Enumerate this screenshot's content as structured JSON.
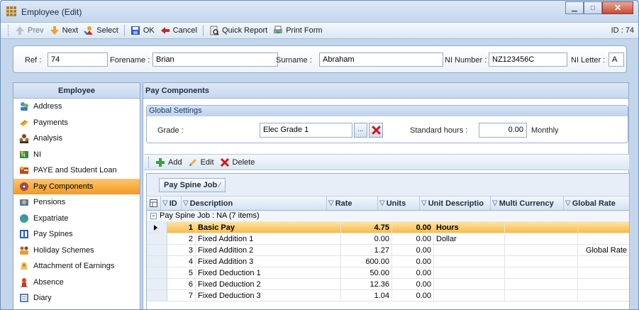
{
  "window": {
    "title": "Employee (Edit)",
    "id_label": "ID : 74"
  },
  "toolbar": {
    "prev": "Prev",
    "next": "Next",
    "select": "Select",
    "ok": "OK",
    "cancel": "Cancel",
    "quick_report": "Quick Report",
    "print_form": "Print Form"
  },
  "employee": {
    "ref_label": "Ref :",
    "ref": "74",
    "forename_label": "Forename :",
    "forename": "Brian",
    "surname_label": "Surname :",
    "surname": "Abraham",
    "ni_number_label": "NI Number :",
    "ni_number": "NZ123456C",
    "ni_letter_label": "NI Letter :",
    "ni_letter": "A"
  },
  "sidebar": {
    "title": "Employee",
    "items": [
      {
        "label": "Address",
        "icon": "address-icon"
      },
      {
        "label": "Payments",
        "icon": "payments-icon"
      },
      {
        "label": "Analysis",
        "icon": "analysis-icon"
      },
      {
        "label": "NI",
        "icon": "ni-icon"
      },
      {
        "label": "PAYE and Student Loan",
        "icon": "paye-icon"
      },
      {
        "label": "Pay Components",
        "icon": "pay-components-icon",
        "selected": true
      },
      {
        "label": "Pensions",
        "icon": "pensions-icon"
      },
      {
        "label": "Expatriate",
        "icon": "expatriate-icon"
      },
      {
        "label": "Pay Spines",
        "icon": "pay-spines-icon"
      },
      {
        "label": "Holiday Schemes",
        "icon": "holiday-schemes-icon"
      },
      {
        "label": "Attachment of Earnings",
        "icon": "attachment-icon"
      },
      {
        "label": "Absence",
        "icon": "absence-icon"
      },
      {
        "label": "Diary",
        "icon": "diary-icon"
      }
    ]
  },
  "main": {
    "title": "Pay Components",
    "global_settings": {
      "title": "Global Settings",
      "grade_label": "Grade :",
      "grade": "Elec Grade 1",
      "browse": "...",
      "std_hours_label": "Standard hours :",
      "std_hours": "0.00",
      "period": "Monthly"
    },
    "grid_toolbar": {
      "add": "Add",
      "edit": "Edit",
      "delete": "Delete"
    },
    "grid": {
      "group_by": "Pay Spine Job",
      "group_row": "Pay Spine Job : NA (7 items)",
      "columns": [
        "ID",
        "Description",
        "Rate",
        "Units",
        "Unit Descriptio",
        "Multi Currency",
        "Global Rate"
      ],
      "rows": [
        {
          "id": "1",
          "description": "Basic Pay",
          "rate": "4.75",
          "units": "0.00",
          "unit_desc": "Hours",
          "multi": "",
          "global": ""
        },
        {
          "id": "2",
          "description": "Fixed Addition 1",
          "rate": "0.00",
          "units": "0.00",
          "unit_desc": "Dollar",
          "multi": "",
          "global": ""
        },
        {
          "id": "3",
          "description": "Fixed Addition 2",
          "rate": "1.27",
          "units": "0.00",
          "unit_desc": "",
          "multi": "",
          "global": "Global Rate"
        },
        {
          "id": "4",
          "description": "Fixed Addition 3",
          "rate": "600.00",
          "units": "0.00",
          "unit_desc": "",
          "multi": "",
          "global": ""
        },
        {
          "id": "5",
          "description": "Fixed Deduction 1",
          "rate": "50.00",
          "units": "0.00",
          "unit_desc": "",
          "multi": "",
          "global": ""
        },
        {
          "id": "6",
          "description": "Fixed Deduction 2",
          "rate": "12.36",
          "units": "0.00",
          "unit_desc": "",
          "multi": "",
          "global": ""
        },
        {
          "id": "7",
          "description": "Fixed Deduction 3",
          "rate": "1.04",
          "units": "0.00",
          "unit_desc": "",
          "multi": "",
          "global": ""
        }
      ]
    }
  }
}
